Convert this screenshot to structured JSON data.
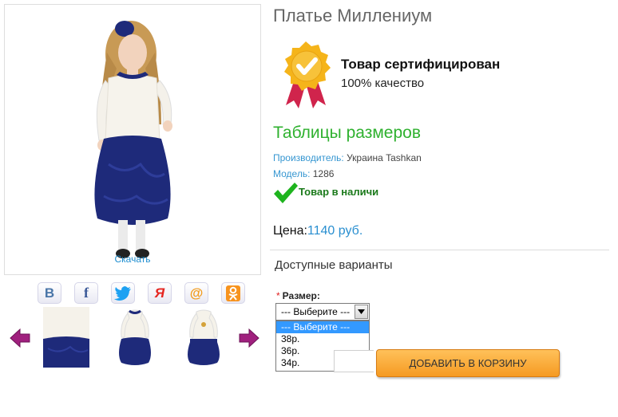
{
  "product": {
    "title": "Платье Миллениум",
    "download_label": "Скачать",
    "certificate_title": "Товар сертифицирован",
    "certificate_subtitle": "100% качество",
    "size_table_link": "Таблицы размеров",
    "manufacturer_label": "Производитель:",
    "manufacturer_value": " Украина Tashkan",
    "model_label": "Модель:",
    "model_value": " 1286",
    "stock_status": "Товар в наличи",
    "price_label": "Цена:",
    "price_value": "1140 руб."
  },
  "social": [
    {
      "icon": "vk-icon",
      "glyph": "B",
      "color": "#4a76a8"
    },
    {
      "icon": "facebook-icon",
      "glyph": "f",
      "color": "#3b5998"
    },
    {
      "icon": "twitter-icon",
      "glyph": "",
      "color": "#1da1f2"
    },
    {
      "icon": "yandex-icon",
      "glyph": "Я",
      "color": "#e52620"
    },
    {
      "icon": "mail-ru-icon",
      "glyph": "@",
      "color": "#f29b1b"
    },
    {
      "icon": "odnoklassniki-icon",
      "glyph": "ok",
      "color": "#f7931e"
    }
  ],
  "options": {
    "heading": "Доступные варианты",
    "size_label": "Размер:",
    "required_mark": "*",
    "selected": "--- Выберите ---",
    "choices": [
      "--- Выберите ---",
      "38р.",
      "36р.",
      "34р."
    ]
  },
  "cart": {
    "add_label": "ДОБАВИТЬ В КОРЗИНУ"
  },
  "colors": {
    "accent_blue": "#2a8fd0",
    "green": "#2fb12f",
    "button_orange": "#f59a22",
    "arrow_purple": "#a0207e"
  }
}
